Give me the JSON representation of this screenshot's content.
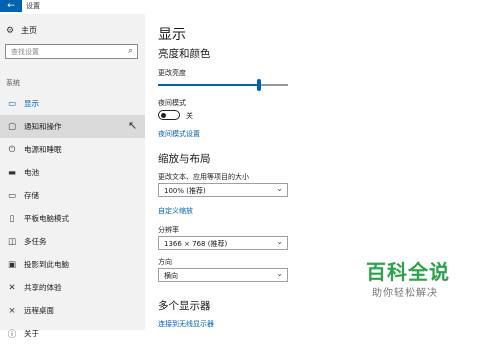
{
  "window": {
    "title": "设置",
    "back_icon": "arrow-left-icon"
  },
  "sidebar": {
    "home_label": "主页",
    "search_placeholder": "查找设置",
    "section": "系统",
    "items": [
      {
        "label": "显示",
        "icon": "monitor-icon",
        "active": true
      },
      {
        "label": "通知和操作",
        "icon": "notification-icon"
      },
      {
        "label": "电源和睡眠",
        "icon": "power-icon"
      },
      {
        "label": "电池",
        "icon": "battery-icon"
      },
      {
        "label": "存储",
        "icon": "storage-icon"
      },
      {
        "label": "平板电脑模式",
        "icon": "tablet-icon"
      },
      {
        "label": "多任务",
        "icon": "multitask-icon"
      },
      {
        "label": "投影到此电脑",
        "icon": "project-icon"
      },
      {
        "label": "共享的体验",
        "icon": "share-icon"
      },
      {
        "label": "远程桌面",
        "icon": "remote-desktop-icon"
      },
      {
        "label": "关于",
        "icon": "info-icon"
      }
    ]
  },
  "main": {
    "title": "显示",
    "brightness_section": "亮度和颜色",
    "brightness_label": "更改亮度",
    "brightness_level": 0.78,
    "night_light_label": "夜间模式",
    "night_light_state": "关",
    "night_light_settings_link": "夜间模式设置",
    "scale_section": "缩放与布局",
    "scale_label": "更改文本、应用等项目的大小",
    "scale_value": "100% (推荐)",
    "custom_scale_link": "自定义缩放",
    "resolution_label": "分辨率",
    "resolution_value": "1366 × 768 (推荐)",
    "orientation_label": "方向",
    "orientation_value": "横向",
    "multi_display_section": "多个显示器",
    "wireless_link": "连接到无线显示器"
  },
  "watermark": {
    "line1": "百科全说",
    "line2": "助你轻松解决",
    "color": "#2aa34a"
  },
  "colors": {
    "accent": "#0063b1",
    "sidebar_bg": "#f2f2f2",
    "hover_bg": "#dadada"
  }
}
